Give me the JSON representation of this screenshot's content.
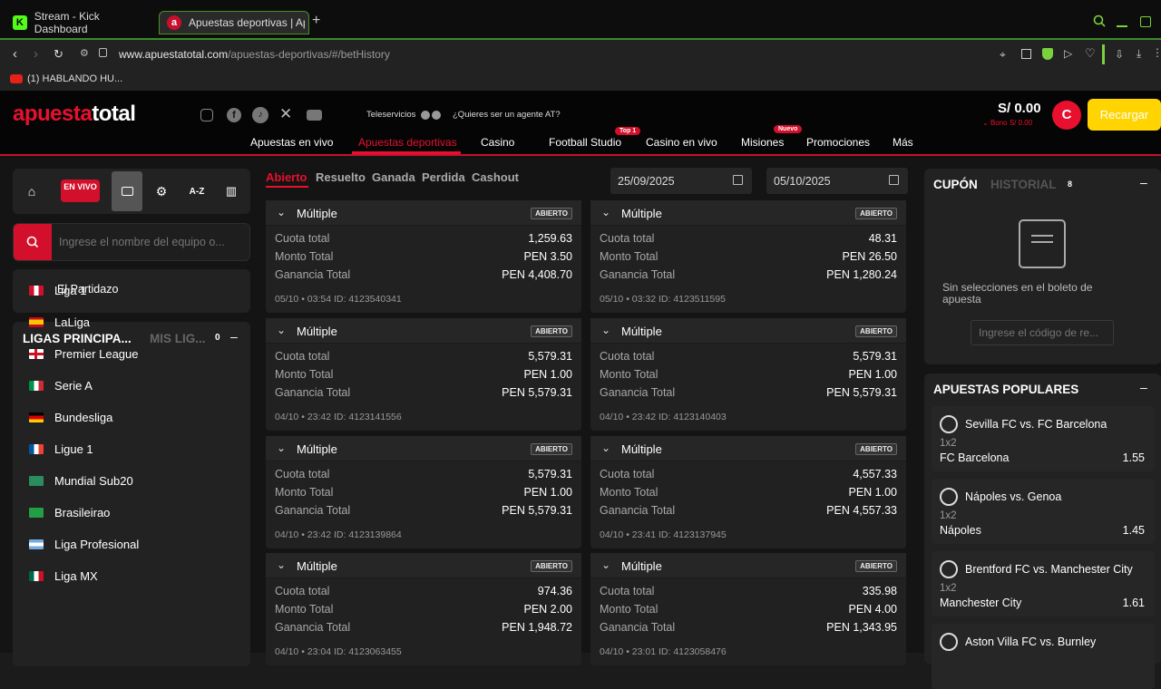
{
  "browser": {
    "tabs": [
      {
        "title": "Stream - Kick Dashboard",
        "icon": "kick-icon"
      },
      {
        "title": "Apuestas deportivas | Ap",
        "icon": "apuesta-icon"
      }
    ],
    "new_tab": "+",
    "url_domain": "www.apuestatotal.com",
    "url_path": "/apuestas-deportivas/#/betHistory",
    "bookmark": "(1) HABLANDO HU..."
  },
  "header": {
    "logo_a": "apuesta",
    "logo_b": "total",
    "teleservicios": "Teleservicios",
    "agent": "¿Quieres ser un agente AT?",
    "balance": "S/ 0.00",
    "bono": "Bono S/ 0.00",
    "avatar": "C",
    "recargar": "Recargar",
    "nav": [
      {
        "label": "Apuestas en vivo"
      },
      {
        "label": "Apuestas deportivas"
      },
      {
        "label": "Casino"
      },
      {
        "label": "Football Studio",
        "badge": "Top 1"
      },
      {
        "label": "Casino en vivo"
      },
      {
        "label": "Misiones",
        "badge": "Nuevo"
      },
      {
        "label": "Promociones"
      },
      {
        "label": "Más"
      }
    ]
  },
  "sidebar": {
    "en_vivo": "EN VIVO",
    "az": "A-Z",
    "search_placeholder": "Ingrese el nombre del equipo o...",
    "partidazo": "El Partidazo",
    "ligas_title": "LIGAS PRINCIPA...",
    "mis_ligas": "MIS LIG...",
    "mis_count": "0",
    "collapse": "–",
    "leagues": [
      {
        "name": "Liga 1"
      },
      {
        "name": "LaLiga"
      },
      {
        "name": "Premier League"
      },
      {
        "name": "Serie A"
      },
      {
        "name": "Bundesliga"
      },
      {
        "name": "Ligue 1"
      },
      {
        "name": "Mundial Sub20"
      },
      {
        "name": "Brasileirao"
      },
      {
        "name": "Liga Profesional"
      },
      {
        "name": "Liga MX"
      }
    ]
  },
  "filters": [
    "Abierto",
    "Resuelto",
    "Ganada",
    "Perdida",
    "Cashout"
  ],
  "dates": {
    "from": "25/09/2025",
    "to": "05/10/2025"
  },
  "labels": {
    "cuota": "Cuota total",
    "monto": "Monto Total",
    "ganancia": "Ganancia Total",
    "multiple": "Múltiple",
    "status": "ABIERTO"
  },
  "bets": [
    {
      "cuota": "1,259.63",
      "monto": "PEN 3.50",
      "ganancia": "PEN 4,408.70",
      "foot": "05/10 • 03:54  ID: 4123540341"
    },
    {
      "cuota": "48.31",
      "monto": "PEN 26.50",
      "ganancia": "PEN 1,280.24",
      "foot": "05/10 • 03:32  ID: 4123511595"
    },
    {
      "cuota": "5,579.31",
      "monto": "PEN 1.00",
      "ganancia": "PEN 5,579.31",
      "foot": "04/10 • 23:42  ID: 4123141556"
    },
    {
      "cuota": "5,579.31",
      "monto": "PEN 1.00",
      "ganancia": "PEN 5,579.31",
      "foot": "04/10 • 23:42  ID: 4123140403"
    },
    {
      "cuota": "5,579.31",
      "monto": "PEN 1.00",
      "ganancia": "PEN 5,579.31",
      "foot": "04/10 • 23:42  ID: 4123139864"
    },
    {
      "cuota": "4,557.33",
      "monto": "PEN 1.00",
      "ganancia": "PEN 4,557.33",
      "foot": "04/10 • 23:41  ID: 4123137945"
    },
    {
      "cuota": "974.36",
      "monto": "PEN 2.00",
      "ganancia": "PEN 1,948.72",
      "foot": "04/10 • 23:04  ID: 4123063455"
    },
    {
      "cuota": "335.98",
      "monto": "PEN 4.00",
      "ganancia": "PEN 1,343.95",
      "foot": "04/10 • 23:01  ID: 4123058476"
    }
  ],
  "coupon": {
    "tab1": "CUPÓN",
    "tab2": "HISTORIAL",
    "count": "8",
    "empty": "Sin selecciones en el boleto de apuesta",
    "code_placeholder": "Ingrese el código de re..."
  },
  "popular": {
    "title": "APUESTAS POPULARES",
    "items": [
      {
        "match": "Sevilla FC vs. FC Barcelona",
        "market": "1x2",
        "pick": "FC Barcelona",
        "odd": "1.55"
      },
      {
        "match": "Nápoles vs. Genoa",
        "market": "1x2",
        "pick": "Nápoles",
        "odd": "1.45"
      },
      {
        "match": "Brentford FC vs. Manchester City",
        "market": "1x2",
        "pick": "Manchester City",
        "odd": "1.61"
      },
      {
        "match": "Aston Villa FC vs. Burnley",
        "market": "",
        "pick": "",
        "odd": ""
      }
    ]
  },
  "colors": {
    "brand_red": "#d3102c",
    "recargar": "#ffd400",
    "tab_green": "#3a8d2c"
  }
}
